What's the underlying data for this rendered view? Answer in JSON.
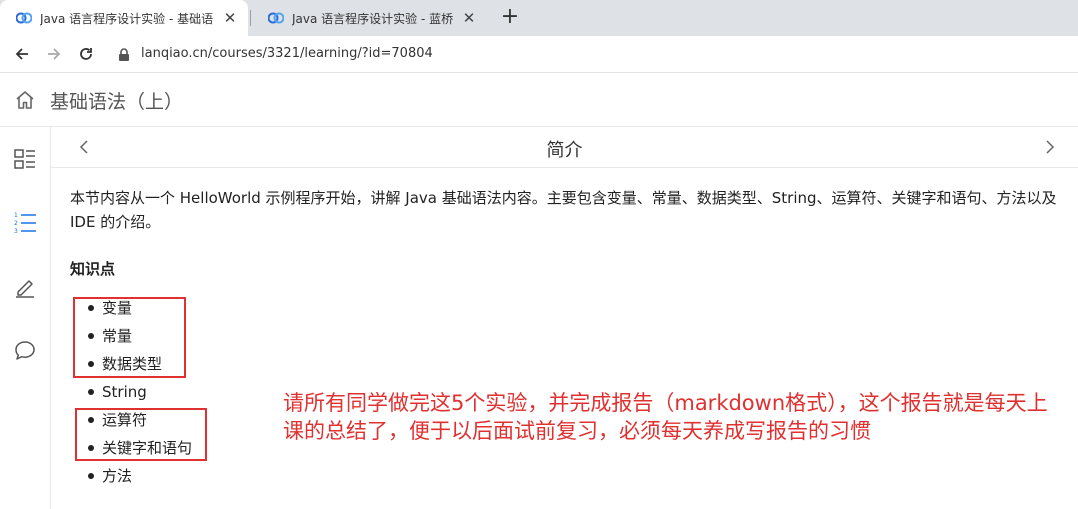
{
  "browser": {
    "tabs": [
      {
        "title": "Java 语言程序设计实验 - 基础语",
        "active": true
      },
      {
        "title": "Java 语言程序设计实验 - 蓝桥",
        "active": false
      }
    ],
    "address_bar": {
      "url": "lanqiao.cn/courses/3321/learning/?id=70804"
    }
  },
  "header": {
    "title": "基础语法（上）"
  },
  "sidebar": {
    "items": [
      {
        "icon": "catalog-icon"
      },
      {
        "icon": "numbered-list-icon",
        "active": true
      },
      {
        "icon": "pencil-icon"
      },
      {
        "icon": "chat-bubble-icon"
      }
    ]
  },
  "content": {
    "section_title": "简介",
    "intro": "本节内容从一个 HelloWorld 示例程序开始，讲解 Java 基础语法内容。主要包含变量、常量、数据类型、String、运算符、关键字和语句、方法以及 IDE 的介绍。",
    "knowledge_title": "知识点",
    "knowledge_points": [
      "变量",
      "常量",
      "数据类型",
      "String",
      "运算符",
      "关键字和语句",
      "方法"
    ]
  },
  "annotation": {
    "text": "请所有同学做完这5个实验，并完成报告（markdown格式），这个报告就是每天上课的总结了，便于以后面试前复习，必须每天养成写报告的习惯",
    "color": "#e03030"
  },
  "colors": {
    "accent": "#1a73e8",
    "annotation": "#e03030"
  }
}
